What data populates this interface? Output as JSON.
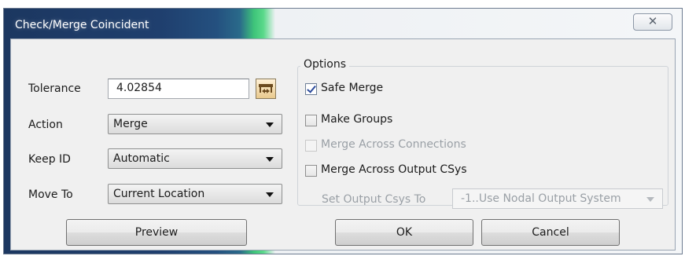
{
  "window": {
    "title": "Check/Merge Coincident",
    "close_glyph": "✕"
  },
  "form": {
    "tolerance_label": "Tolerance",
    "tolerance_value": "4.02854",
    "action_label": "Action",
    "action_value": "Merge",
    "keep_id_label": "Keep ID",
    "keep_id_value": "Automatic",
    "move_to_label": "Move To",
    "move_to_value": "Current Location"
  },
  "options": {
    "legend": "Options",
    "safe_merge": {
      "label": "Safe Merge",
      "checked": true,
      "enabled": true
    },
    "make_groups": {
      "label": "Make Groups",
      "checked": false,
      "enabled": true
    },
    "merge_across_connections": {
      "label": "Merge Across Connections",
      "checked": false,
      "enabled": false
    },
    "merge_across_output_csys": {
      "label": "Merge Across Output CSys",
      "checked": false,
      "enabled": true
    },
    "set_output_csys_label": "Set Output Csys To",
    "set_output_csys_value": "-1..Use Nodal Output System"
  },
  "buttons": {
    "preview": "Preview",
    "ok": "OK",
    "cancel": "Cancel"
  },
  "icons": {
    "pick_tolerance": "measure-distance-icon"
  }
}
